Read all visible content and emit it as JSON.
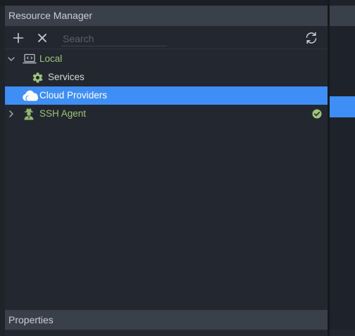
{
  "panel": {
    "title": "Resource Manager"
  },
  "toolbar": {
    "add_icon": "plus-icon",
    "remove_icon": "x-icon",
    "refresh_icon": "refresh-icon",
    "search_placeholder": "Search",
    "search_value": ""
  },
  "tree": {
    "items": [
      {
        "label": "Local",
        "icon": "laptop-code-icon",
        "expanded": true,
        "color": "#9ec37a"
      },
      {
        "label": "Services",
        "icon": "gear-icon",
        "color": "#d4d8df"
      },
      {
        "label": "Cloud Providers",
        "icon": "cloud-icon",
        "selected": true,
        "color": "#ffffff"
      },
      {
        "label": "SSH Agent",
        "icon": "agent-icon",
        "expanded": false,
        "status": "ok",
        "color": "#9ec37a"
      }
    ]
  },
  "properties": {
    "title": "Properties"
  },
  "colors": {
    "accent": "#3f8ef5",
    "header_bg": "#3a404a",
    "panel_bg": "#23272f",
    "green": "#9ec37a"
  }
}
